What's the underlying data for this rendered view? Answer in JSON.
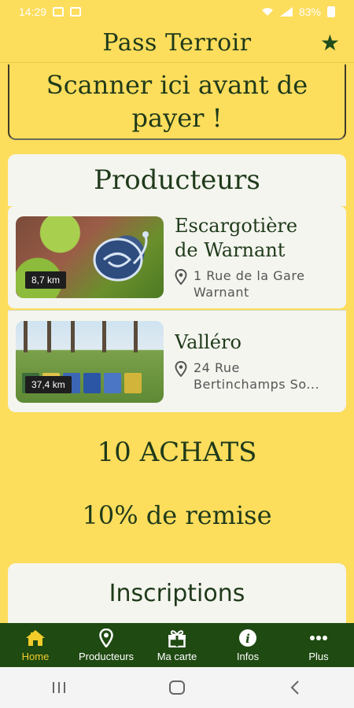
{
  "status_bar": {
    "time": "14:29",
    "battery": "83%"
  },
  "app": {
    "title": "Pass Terroir"
  },
  "scan": {
    "text_line1": "Scanner ici avant de",
    "text_line2": "payer !"
  },
  "producers": {
    "heading": "Producteurs",
    "items": [
      {
        "name_line1": "Escargotière",
        "name_line2": "de Warnant",
        "address_line1": "1 Rue de la Gare",
        "address_line2": "Warnant",
        "distance": "8,7 km"
      },
      {
        "name_line1": "Valléro",
        "name_line2": "",
        "address_line1": "24 Rue",
        "address_line2": "Bertinchamps So...",
        "distance": "37,4 km"
      }
    ]
  },
  "stats": {
    "purchases": "10 ACHATS",
    "discount": "10% de remise"
  },
  "registrations": {
    "heading": "Inscriptions"
  },
  "bottom_nav": {
    "items": [
      {
        "label": "Home",
        "icon": "home-icon"
      },
      {
        "label": "Producteurs",
        "icon": "location-pin-icon"
      },
      {
        "label": "Ma carte",
        "icon": "gift-icon"
      },
      {
        "label": "Infos",
        "icon": "info-icon"
      },
      {
        "label": "Plus",
        "icon": "more-dots-icon"
      }
    ]
  },
  "colors": {
    "background": "#FDDD5C",
    "nav_bg": "#1F4A12",
    "active": "#F2CC2B",
    "text": "#1F3A1A"
  }
}
